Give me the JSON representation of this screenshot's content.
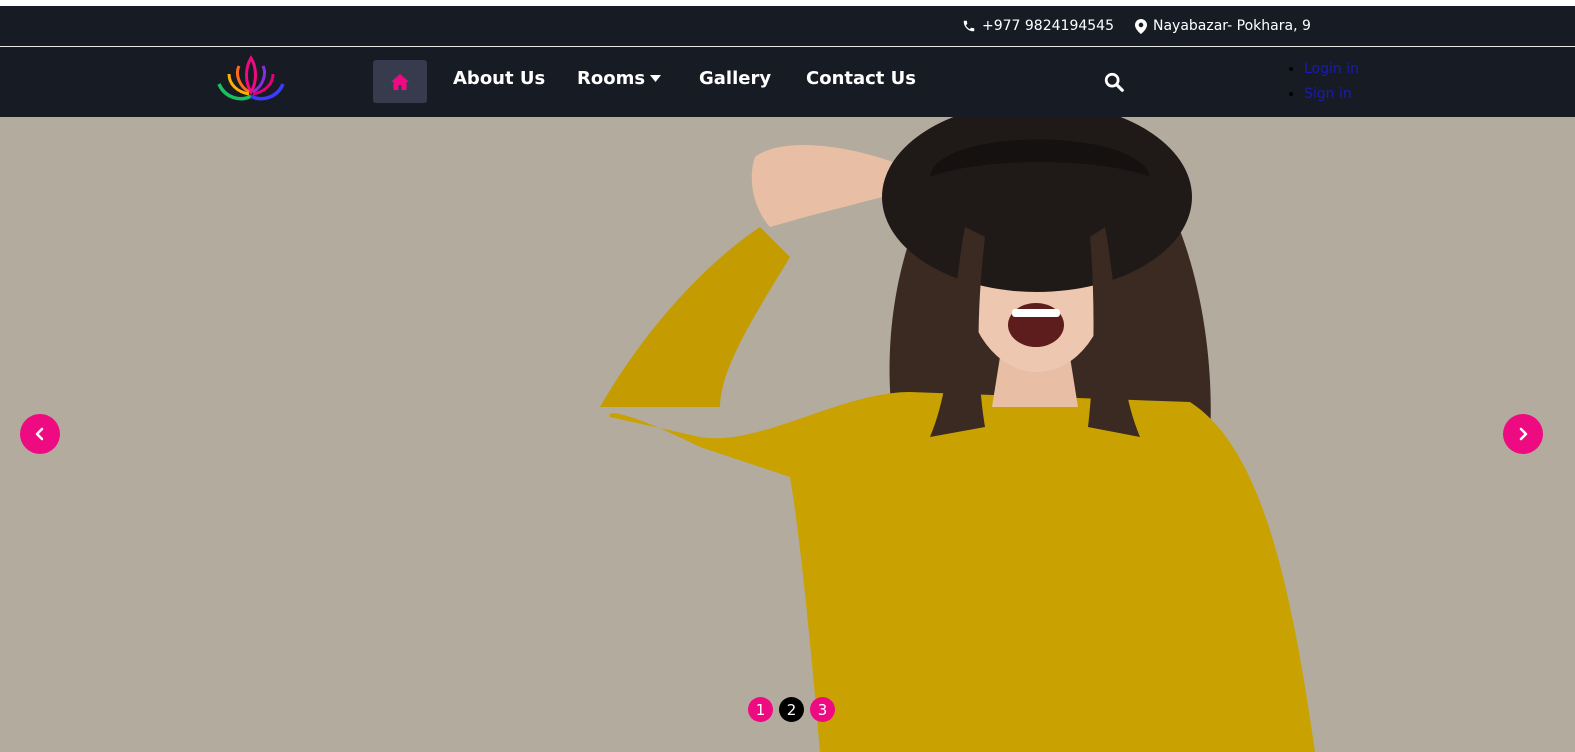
{
  "topbar": {
    "phone": "+977 9824194545",
    "address": "Nayabazar- Pokhara, 9",
    "phone_icon": "phone-icon",
    "address_icon": "map-pin-icon"
  },
  "nav": {
    "home_icon": "home-icon",
    "about": "About Us",
    "rooms": "Rooms",
    "gallery": "Gallery",
    "contact": "Contact Us",
    "search_icon": "search-icon",
    "auth": {
      "login": "Login in",
      "signin": "Sign in"
    }
  },
  "slider": {
    "pages": [
      "1",
      "2",
      "3"
    ],
    "active_page": "2",
    "prev_icon": "chevron-left-icon",
    "next_icon": "chevron-right-icon"
  },
  "colors": {
    "dark_bar": "#171b24",
    "accent": "#ee0a80",
    "hero_bg": "#b3ac9e",
    "home_button_bg": "#363c4e"
  }
}
